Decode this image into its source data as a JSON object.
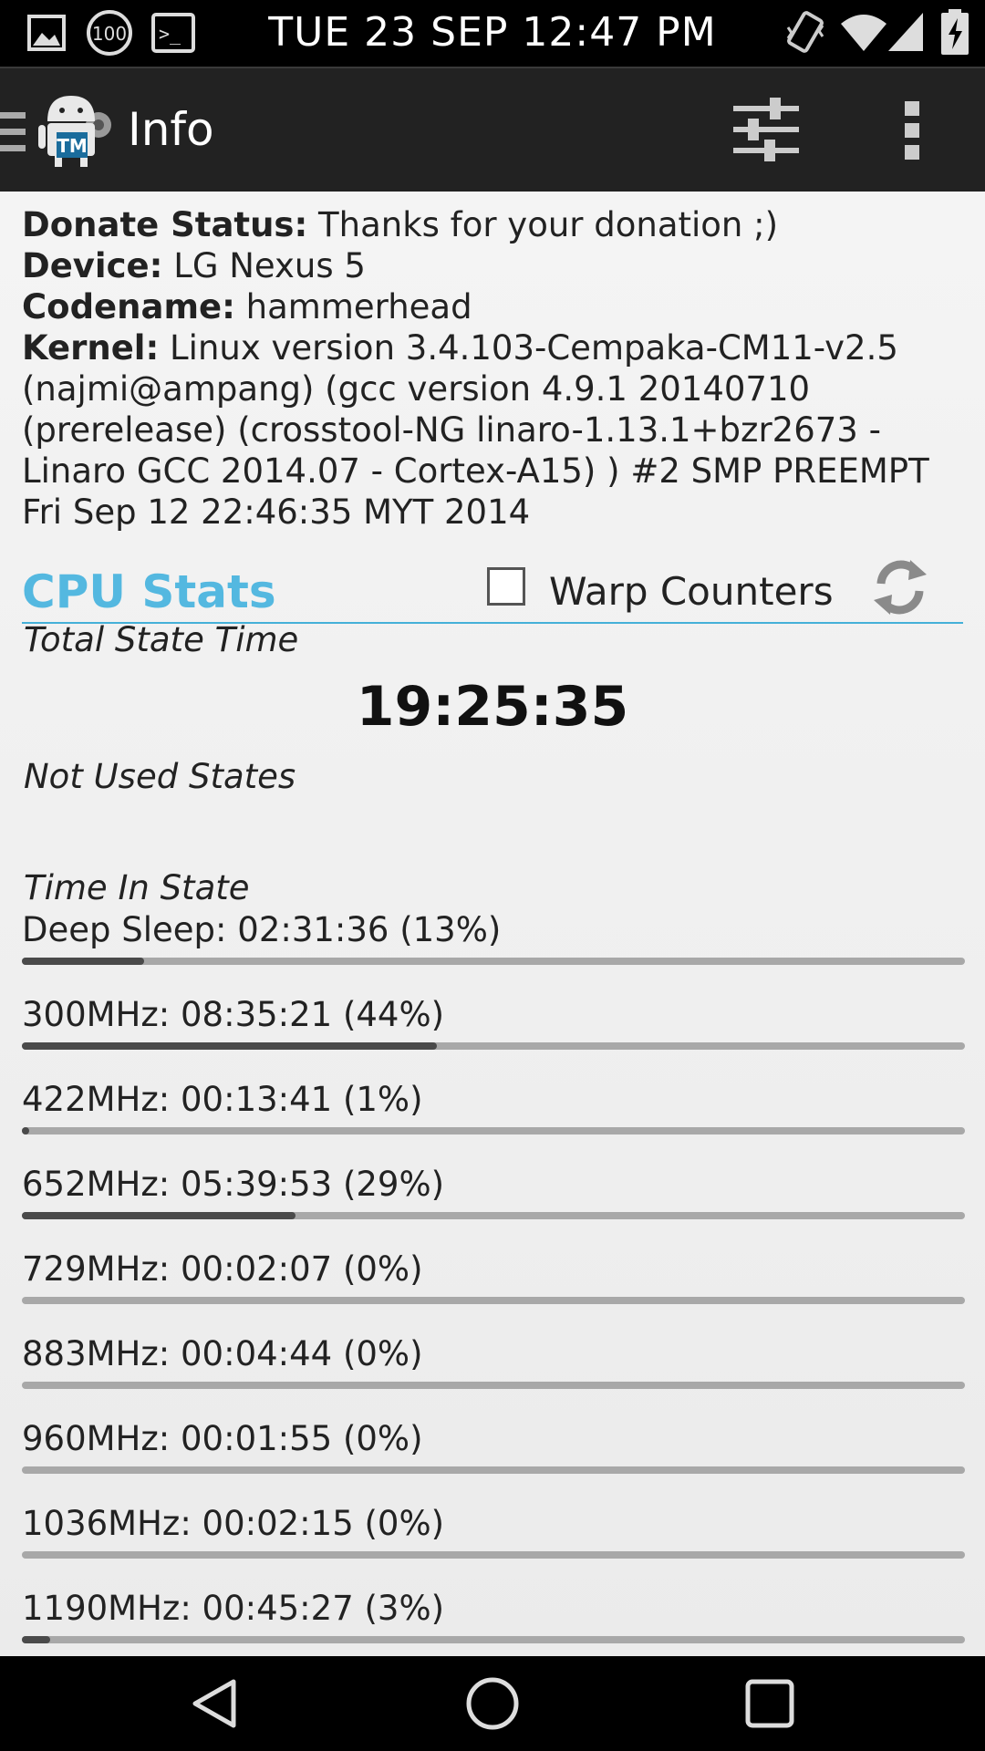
{
  "status_bar": {
    "time": "TUE 23 SEP 12:47 PM",
    "icons": [
      "image-icon",
      "battery-100-icon",
      "terminal-icon",
      "vibrate-icon",
      "wifi-icon",
      "signal-icon",
      "battery-charging-icon"
    ],
    "badge_100": "100"
  },
  "action_bar": {
    "title": "Info",
    "icons": [
      "menu-icon",
      "app-logo-icon",
      "tune-icon",
      "overflow-menu-icon"
    ]
  },
  "info": {
    "donate_label": "Donate Status:",
    "donate_value": "Thanks for your donation ;)",
    "device_label": "Device:",
    "device_value": "LG Nexus 5",
    "codename_label": "Codename:",
    "codename_value": "hammerhead",
    "kernel_label": "Kernel:",
    "kernel_value": "Linux version 3.4.103-Cempaka-CM11-v2.5 (najmi@ampang) (gcc version 4.9.1 20140710 (prerelease) (crosstool-NG linaro-1.13.1+bzr2673 - Linaro GCC 2014.07 - Cortex-A15) ) #2 SMP PREEMPT Fri Sep 12 22:46:35 MYT 2014"
  },
  "cpu": {
    "title": "CPU Stats",
    "warp_label": "Warp Counters",
    "warp_checked": false,
    "total_label": "Total State Time",
    "total_value": "19:25:35",
    "not_used_label": "Not Used States",
    "time_in_state_label": "Time In State",
    "accent": "#54b8e0",
    "states": [
      {
        "text": "Deep Sleep: 02:31:36 (13%)",
        "percent": 13
      },
      {
        "text": "300MHz: 08:35:21 (44%)",
        "percent": 44
      },
      {
        "text": "422MHz: 00:13:41 (1%)",
        "percent": 1
      },
      {
        "text": "652MHz: 05:39:53 (29%)",
        "percent": 29
      },
      {
        "text": "729MHz: 00:02:07 (0%)",
        "percent": 0
      },
      {
        "text": "883MHz: 00:04:44 (0%)",
        "percent": 0
      },
      {
        "text": "960MHz: 00:01:55 (0%)",
        "percent": 0
      },
      {
        "text": "1036MHz: 00:02:15 (0%)",
        "percent": 0
      },
      {
        "text": "1190MHz: 00:45:27 (3%)",
        "percent": 3
      }
    ]
  },
  "nav_bar": {
    "icons": [
      "back-icon",
      "home-icon",
      "recents-icon"
    ]
  }
}
